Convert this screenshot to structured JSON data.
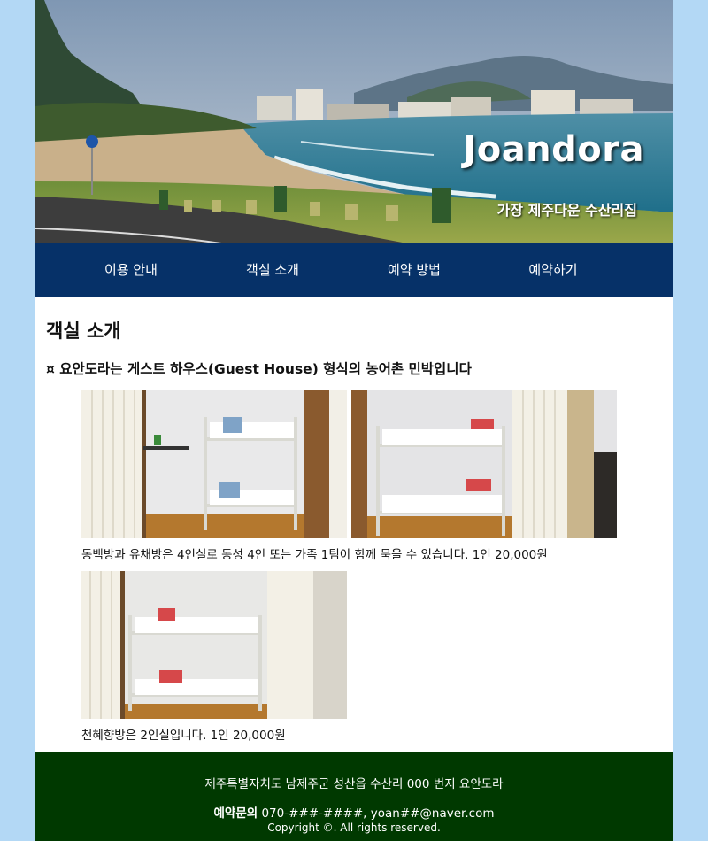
{
  "header": {
    "brand": "Joandora",
    "tagline": "가장 제주다운 수산리집"
  },
  "nav": {
    "items": [
      "이용 안내",
      "객실 소개",
      "예약 방법",
      "예약하기"
    ]
  },
  "main": {
    "title": "객실 소개",
    "subtitle": "¤ 요안도라는 게스트 하우스(Guest House) 형식의 농어촌 민박입니다",
    "captions": [
      "동백방과 유채방은 4인실로 동성 4인 또는 가족 1팀이 함께 묵을 수 있습니다. 1인 20,000원",
      "천혜향방은 2인실입니다. 1인 20,000원"
    ]
  },
  "footer": {
    "address": "제주특별자치도 남제주군 성산읍 수산리 000 번지 요안도라",
    "contact_label": "예약문의",
    "contact_value": " 070-###-####, yoan##@naver.com",
    "copyright": "Copyright ©. All rights reserved."
  }
}
